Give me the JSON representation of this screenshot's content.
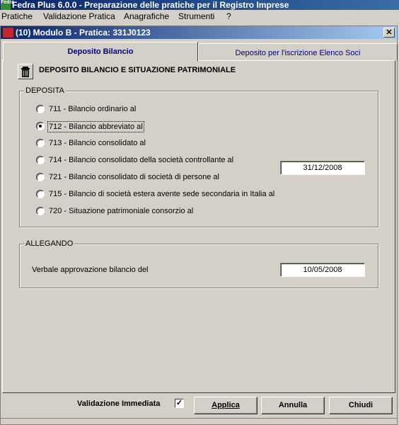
{
  "app": {
    "icon_text": "Fedra",
    "title": "Fedra Plus 6.0.0 - Preparazione delle pratiche per il Registro Imprese"
  },
  "menu": [
    "Pratiche",
    "Validazione Pratica",
    "Anagrafiche",
    "Strumenti",
    "?"
  ],
  "child_window": {
    "title": "(10) Modulo B - Pratica: 331J0123",
    "close_glyph": "✕"
  },
  "tabs": [
    {
      "label": "Deposito Bilancio",
      "selected": true
    },
    {
      "label": "Deposito per l'iscrizione Elenco Soci",
      "selected": false
    }
  ],
  "section_title": "DEPOSITO BILANCIO E SITUAZIONE PATRIMONIALE",
  "deposita": {
    "legend": "DEPOSITA",
    "options": [
      {
        "label": "711 - Bilancio ordinario al",
        "checked": false
      },
      {
        "label": "712 - Bilancio abbreviato al",
        "checked": true,
        "date": "31/12/2008"
      },
      {
        "label": "713 - Bilancio consolidato al",
        "checked": false
      },
      {
        "label": "714 - Bilancio consolidato della società controllante al",
        "checked": false
      },
      {
        "label": "721 - Bilancio consolidato di società di persone al",
        "checked": false
      },
      {
        "label": "715 - Bilancio di società estera avente sede secondaria in Italia al",
        "checked": false
      },
      {
        "label": "720 - Situazione patrimoniale consorzio al",
        "checked": false
      }
    ]
  },
  "allegando": {
    "legend": "ALLEGANDO",
    "label": "Verbale approvazione bilancio del",
    "date": "10/05/2008"
  },
  "footer": {
    "validazione_label": "Validazione Immediata",
    "validazione_checked": true,
    "check_glyph": "✓",
    "buttons": {
      "applica": "Applica",
      "annulla": "Annulla",
      "chiudi": "Chiudi"
    }
  },
  "colors": {
    "window_bg": "#d4d0c8",
    "title_bar": "#0a246a",
    "tab_text": "#00007f"
  },
  "icons": [
    "app-logo-icon",
    "window-icon",
    "close-icon",
    "trash-icon",
    "checkbox-check-icon"
  ]
}
